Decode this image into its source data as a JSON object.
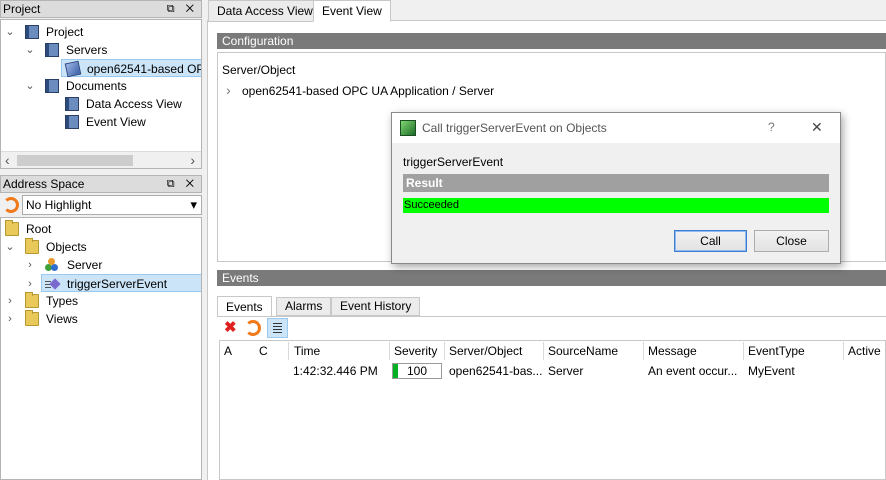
{
  "project_panel": {
    "title": "Project",
    "controls": "⧉ ✕",
    "tree": {
      "project": "Project",
      "servers": "Servers",
      "server_item": "open62541-based OPC",
      "documents": "Documents",
      "data_access_view": "Data Access View",
      "event_view": "Event View"
    },
    "scroll_left": "‹",
    "scroll_right": "›"
  },
  "address_panel": {
    "title": "Address Space",
    "controls": "⧉ ✕",
    "highlight_value": "No Highlight",
    "dropdown_arrow": "▾",
    "tree": {
      "root": "Root",
      "objects": "Objects",
      "server": "Server",
      "trigger": "triggerServerEvent",
      "types": "Types",
      "views": "Views"
    }
  },
  "main_tabs": [
    {
      "label": "Data Access View"
    },
    {
      "label": "Event View"
    }
  ],
  "configuration": {
    "title": "Configuration",
    "column_header": "Server/Object",
    "row_expander": "›",
    "row": "open62541-based OPC UA Application / Server"
  },
  "events": {
    "title": "Events",
    "tabs": [
      {
        "label": "Events"
      },
      {
        "label": "Alarms"
      },
      {
        "label": "Event History"
      }
    ],
    "columns": [
      "A",
      "C",
      "Time",
      "Severity",
      "Server/Object",
      "SourceName",
      "Message",
      "EventType",
      "Active"
    ],
    "rows": [
      {
        "time": "1:42:32.446 PM",
        "severity": "100",
        "severity_fraction": 0.1,
        "server_object": "open62541-bas...",
        "source_name": "Server",
        "message": "An event occur...",
        "event_type": "MyEvent"
      }
    ]
  },
  "dialog": {
    "title": "Call triggerServerEvent on Objects",
    "help": "?",
    "close_glyph": "✕",
    "method_name": "triggerServerEvent",
    "result_header": "Result",
    "result_status": "Succeeded",
    "call_label": "Call",
    "close_label": "Close"
  },
  "colors": {
    "success": "#00ff00",
    "section_bar": "#7a7a7a",
    "selection": "#cce4f7"
  }
}
